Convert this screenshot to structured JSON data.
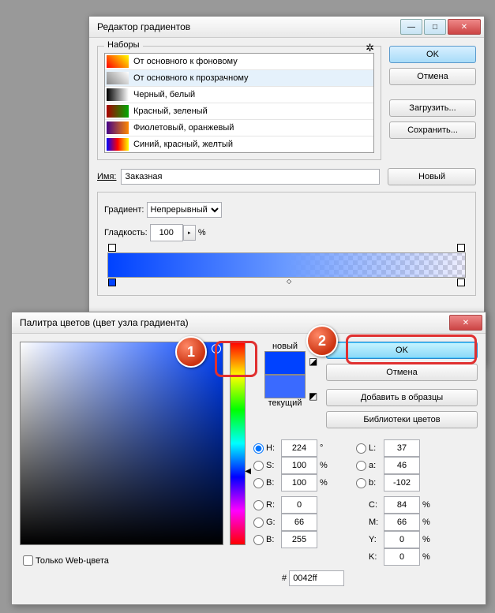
{
  "gradWin": {
    "title": "Редактор градиентов",
    "presetsLabel": "Наборы",
    "presets": [
      {
        "label": "От основного к фоновому",
        "g": "linear-gradient(45deg,#f00,#ff0)"
      },
      {
        "label": "От основного к прозрачному",
        "g": "linear-gradient(45deg,#888,#fff)",
        "sel": true
      },
      {
        "label": "Черный, белый",
        "g": "linear-gradient(90deg,#000,#fff)"
      },
      {
        "label": "Красный, зеленый",
        "g": "linear-gradient(90deg,#a00,#0a0)"
      },
      {
        "label": "Фиолетовый, оранжевый",
        "g": "linear-gradient(90deg,#408,#f80)"
      },
      {
        "label": "Синий, красный, желтый",
        "g": "linear-gradient(90deg,#00f,#f00,#ff0)"
      }
    ],
    "ok": "OK",
    "cancel": "Отмена",
    "load": "Загрузить...",
    "save": "Сохранить...",
    "nameLabel": "Имя:",
    "nameVal": "Заказная",
    "newBtn": "Новый",
    "gradTypeLabel": "Градиент:",
    "gradType": "Непрерывный",
    "smoothLabel": "Гладкость:",
    "smoothVal": "100",
    "pct": "%"
  },
  "colorWin": {
    "title": "Палитра цветов (цвет узла градиента)",
    "ok": "OK",
    "cancel": "Отмена",
    "addSwatch": "Добавить в образцы",
    "libs": "Библиотеки цветов",
    "new": "новый",
    "cur": "текущий",
    "webOnly": "Только Web-цвета",
    "hexLabel": "#",
    "hex": "0042ff",
    "H": {
      "l": "H:",
      "v": "224",
      "u": "°"
    },
    "S": {
      "l": "S:",
      "v": "100",
      "u": "%"
    },
    "Bv": {
      "l": "B:",
      "v": "100",
      "u": "%"
    },
    "R": {
      "l": "R:",
      "v": "0"
    },
    "G": {
      "l": "G:",
      "v": "66"
    },
    "Bb": {
      "l": "B:",
      "v": "255"
    },
    "L": {
      "l": "L:",
      "v": "37"
    },
    "a": {
      "l": "a:",
      "v": "46"
    },
    "b": {
      "l": "b:",
      "v": "-102"
    },
    "C": {
      "l": "C:",
      "v": "84",
      "u": "%"
    },
    "M": {
      "l": "M:",
      "v": "66",
      "u": "%"
    },
    "Y": {
      "l": "Y:",
      "v": "0",
      "u": "%"
    },
    "K": {
      "l": "K:",
      "v": "0",
      "u": "%"
    }
  },
  "badges": {
    "b1": "1",
    "b2": "2"
  },
  "chart_data": null
}
